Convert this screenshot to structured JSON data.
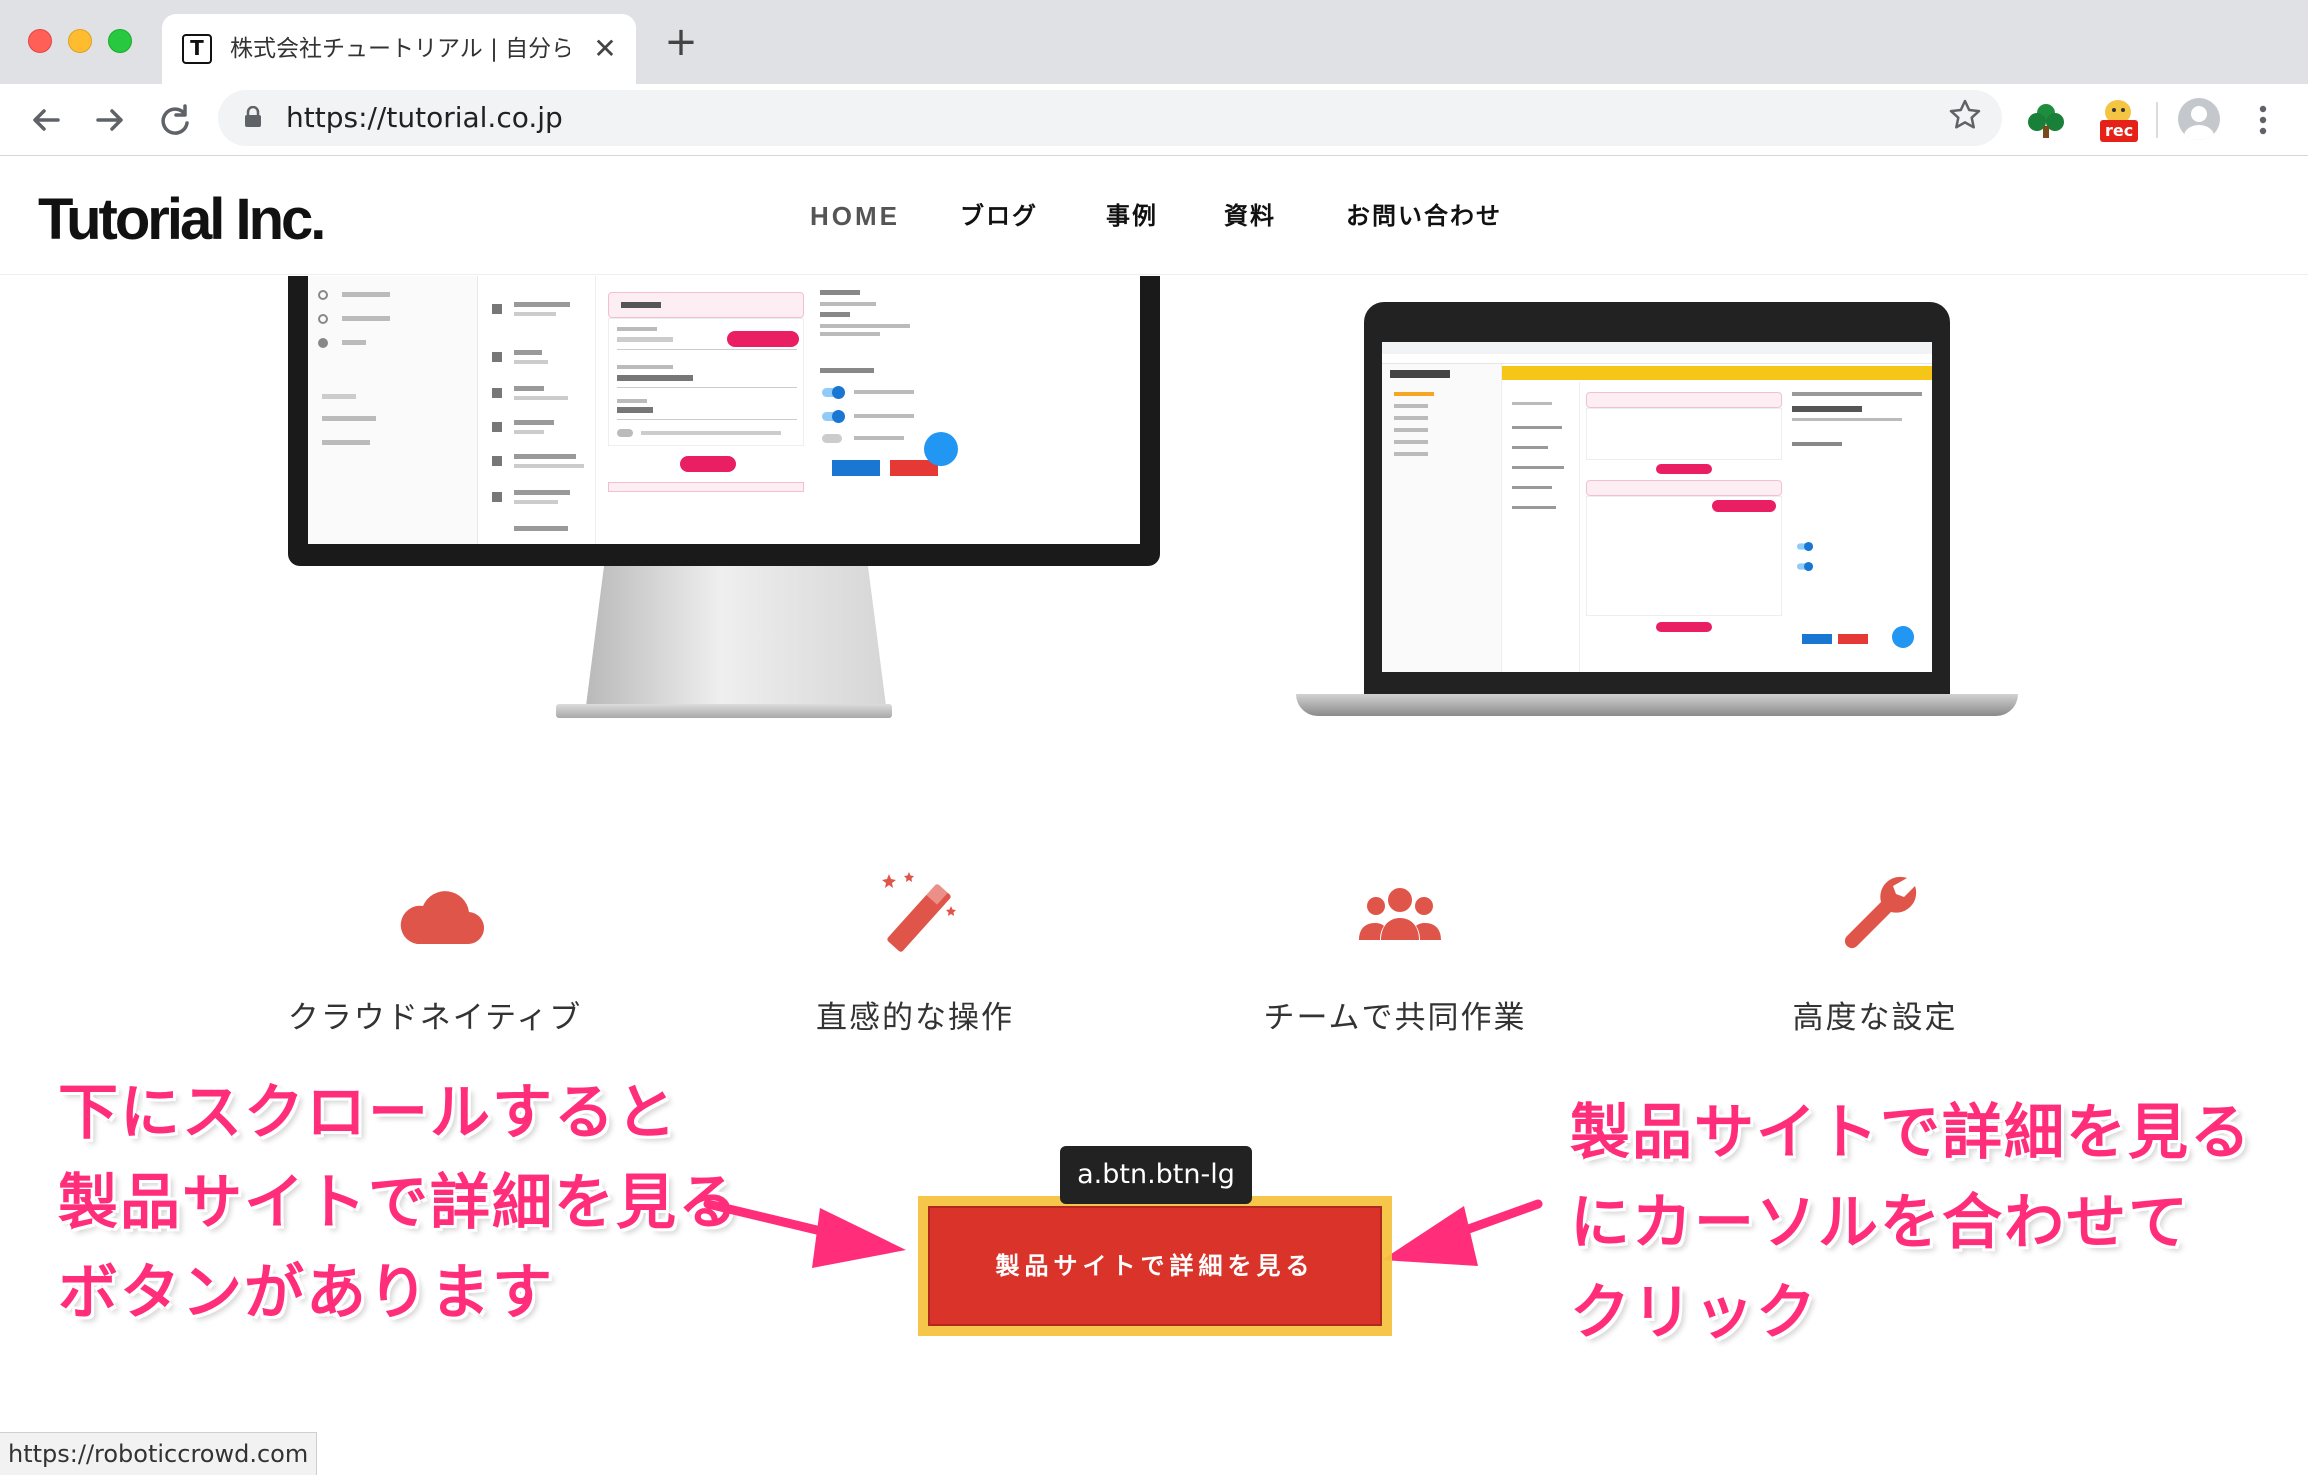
{
  "browser": {
    "tab_title": "株式会社チュートリアル | 自分らし",
    "tab_favicon": "T",
    "tab_close": "✕",
    "new_tab": "+",
    "url": "https://tutorial.co.jp",
    "ext_rec_label": "rec",
    "icons": {
      "back": "arrow-left-icon",
      "forward": "arrow-right-icon",
      "reload": "reload-icon",
      "lock": "lock-icon",
      "bookmark": "star-icon",
      "extension_tree": "tree-icon",
      "extension_rec": "rec-icon",
      "profile": "profile-icon",
      "menu": "kebab-menu-icon"
    }
  },
  "site": {
    "logo": "Tutorial Inc.",
    "nav": [
      {
        "label": "HOME"
      },
      {
        "label": "ブログ"
      },
      {
        "label": "事例"
      },
      {
        "label": "資料"
      },
      {
        "label": "お問い合わせ"
      }
    ]
  },
  "features": [
    {
      "icon": "cloud-icon",
      "label": "クラウドネイティブ"
    },
    {
      "icon": "magic-wand-icon",
      "label": "直感的な操作"
    },
    {
      "icon": "team-icon",
      "label": "チームで共同作業"
    },
    {
      "icon": "wrench-icon",
      "label": "高度な設定"
    }
  ],
  "annotations": {
    "left": [
      "下にスクロールすると",
      "製品サイトで詳細を見る",
      "ボタンがあります"
    ],
    "right": [
      "製品サイトで詳細を見る",
      "にカーソルを合わせて",
      "クリック"
    ]
  },
  "cta": {
    "tooltip": "a.btn.btn-lg",
    "label": "製品サイトで詳細を見る"
  },
  "status_bar": {
    "url": "https://roboticcrowd.com"
  },
  "colors": {
    "accent_red": "#d9332a",
    "icon_red": "#e0554a",
    "annotation_pink": "#ff2d7a",
    "highlight_yellow": "#f6c341"
  }
}
